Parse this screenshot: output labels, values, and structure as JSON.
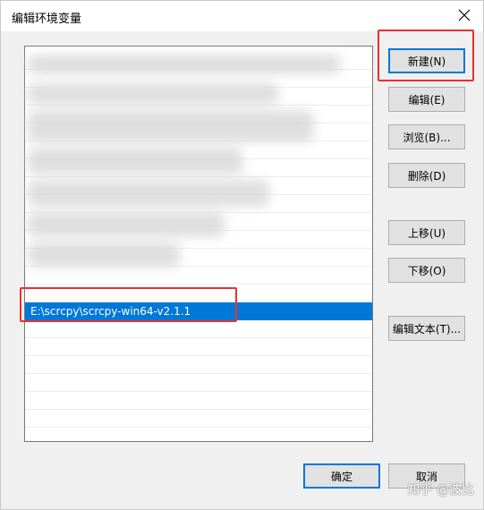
{
  "title": "编辑环境变量",
  "list": {
    "items": [
      {
        "label": "",
        "selected": false
      },
      {
        "label": "",
        "selected": false
      },
      {
        "label": "",
        "selected": false
      },
      {
        "label": "",
        "selected": false
      },
      {
        "label": "",
        "selected": false
      },
      {
        "label": "",
        "selected": false
      },
      {
        "label": "",
        "selected": false
      },
      {
        "label": "",
        "selected": false
      },
      {
        "label": "",
        "selected": false
      },
      {
        "label": "",
        "selected": false
      },
      {
        "label": "",
        "selected": false
      },
      {
        "label": "",
        "selected": false
      },
      {
        "label": "",
        "selected": false
      },
      {
        "label": "",
        "selected": false
      },
      {
        "label": "E:\\scrcpy\\scrcpy-win64-v2.1.1",
        "selected": true
      },
      {
        "label": "",
        "selected": false
      },
      {
        "label": "",
        "selected": false
      },
      {
        "label": "",
        "selected": false
      },
      {
        "label": "",
        "selected": false
      },
      {
        "label": "",
        "selected": false
      },
      {
        "label": "",
        "selected": false
      }
    ]
  },
  "buttons": {
    "new": "新建(N)",
    "edit": "编辑(E)",
    "browse": "浏览(B)...",
    "delete": "删除(D)",
    "move_up": "上移(U)",
    "move_down": "下移(O)",
    "edit_text": "编辑文本(T)...",
    "ok": "确定",
    "cancel": "取消"
  },
  "watermark": "知乎 @波比",
  "colors": {
    "highlight_box": "#e8312f",
    "selection": "#0078d7"
  }
}
